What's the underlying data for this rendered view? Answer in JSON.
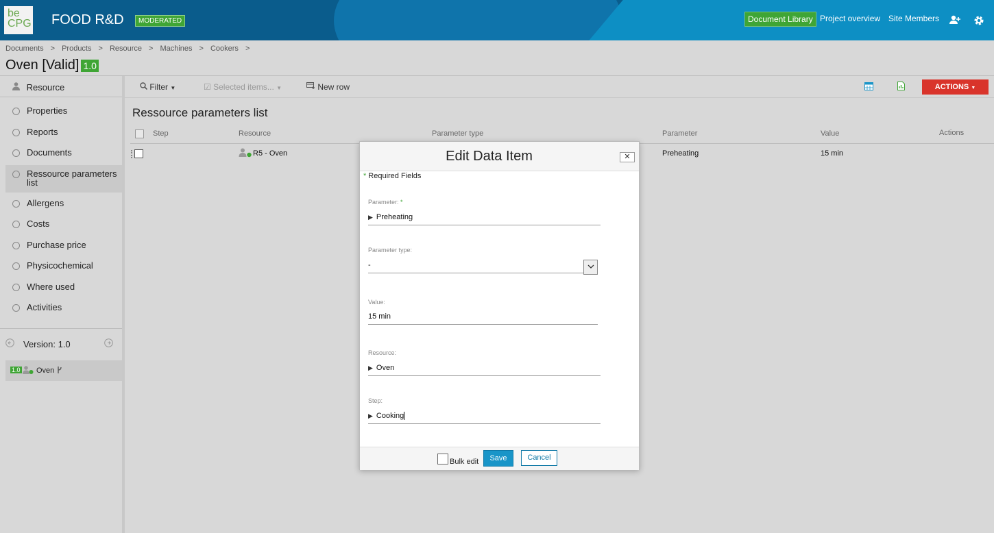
{
  "header": {
    "logo_line1": "be",
    "logo_line2": "CPG",
    "site_title": "FOOD R&D",
    "site_badge": "MODERATED",
    "nav": [
      "Document Library",
      "Project overview",
      "Site Members"
    ],
    "icons": [
      "add-member-icon",
      "gear-icon"
    ]
  },
  "breadcrumb": [
    "Documents",
    ">",
    "Products",
    ">",
    "Resource",
    ">",
    "Machines",
    ">",
    "Cookers",
    ">"
  ],
  "page": {
    "title": "Oven [Valid]",
    "version": "1.0"
  },
  "sidebar": {
    "head": "Resource",
    "items": [
      {
        "label": "Properties"
      },
      {
        "label": "Reports"
      },
      {
        "label": "Documents"
      },
      {
        "label": "Ressource parameters list"
      },
      {
        "label": "Allergens"
      },
      {
        "label": "Costs"
      },
      {
        "label": "Purchase price"
      },
      {
        "label": "Physicochemical"
      },
      {
        "label": "Where used"
      },
      {
        "label": "Activities"
      }
    ],
    "version_label": "Version: 1.0",
    "version_row": {
      "badge": "1.0",
      "name": "Oven"
    }
  },
  "toolbar": {
    "filter": "Filter",
    "selected": "Selected items...",
    "new_row": "New row",
    "actions": "ACTIONS"
  },
  "list": {
    "title": "Ressource parameters list",
    "columns": [
      "Step",
      "Resource",
      "Parameter type",
      "Parameter",
      "Value",
      "Actions"
    ],
    "rows": [
      {
        "step": "",
        "resource": "R5 - Oven",
        "parameter_type": "",
        "parameter": "Preheating",
        "value": "15 min"
      }
    ]
  },
  "dialog": {
    "title": "Edit Data Item",
    "close": "✕",
    "required_note": "Required Fields",
    "fields": {
      "parameter": {
        "label": "Parameter:",
        "value": "Preheating"
      },
      "parameter_type": {
        "label": "Parameter type:",
        "value": "-"
      },
      "value": {
        "label": "Value:",
        "value": "15 min"
      },
      "resource": {
        "label": "Resource:",
        "value": "Oven"
      },
      "step": {
        "label": "Step:",
        "value": "Cooking"
      }
    },
    "bulk_edit": "Bulk edit",
    "save": "Save",
    "cancel": "Cancel"
  }
}
